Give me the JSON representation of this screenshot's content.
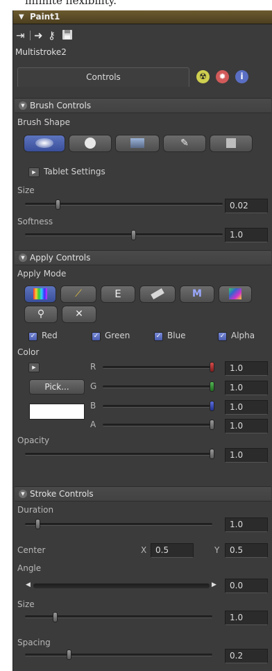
{
  "caption": "infinite flexibility.",
  "panel": {
    "title": "Paint1",
    "tool_name": "Multistroke2"
  },
  "tabs": {
    "controls": "Controls"
  },
  "brush_controls": {
    "header": "Brush Controls",
    "brush_shape_label": "Brush Shape",
    "tablet_settings": "Tablet Settings",
    "size_label": "Size",
    "size_value": "0.02",
    "size_fraction": 0.17,
    "softness_label": "Softness",
    "softness_value": "1.0",
    "softness_fraction": 0.55
  },
  "apply_controls": {
    "header": "Apply Controls",
    "apply_mode_label": "Apply Mode",
    "channels": [
      "Red",
      "Green",
      "Blue",
      "Alpha"
    ],
    "color_label": "Color",
    "pick_label": "Pick...",
    "rgba": [
      {
        "name": "R",
        "value": "1.0",
        "fraction": 1.0
      },
      {
        "name": "G",
        "value": "1.0",
        "fraction": 1.0
      },
      {
        "name": "B",
        "value": "1.0",
        "fraction": 1.0
      },
      {
        "name": "A",
        "value": "1.0",
        "fraction": 1.0
      }
    ],
    "opacity_label": "Opacity",
    "opacity_value": "1.0",
    "opacity_fraction": 1.0
  },
  "stroke_controls": {
    "header": "Stroke Controls",
    "duration_label": "Duration",
    "duration_value": "1.0",
    "duration_fraction": 0.0,
    "center_label": "Center",
    "center_x_label": "X",
    "center_x_value": "0.5",
    "center_y_label": "Y",
    "center_y_value": "0.5",
    "angle_label": "Angle",
    "angle_value": "0.0",
    "size_label": "Size",
    "size_value": "1.0",
    "size_fraction": 0.1,
    "spacing_label": "Spacing",
    "spacing_value": "0.2",
    "spacing_fraction": 0.18
  }
}
